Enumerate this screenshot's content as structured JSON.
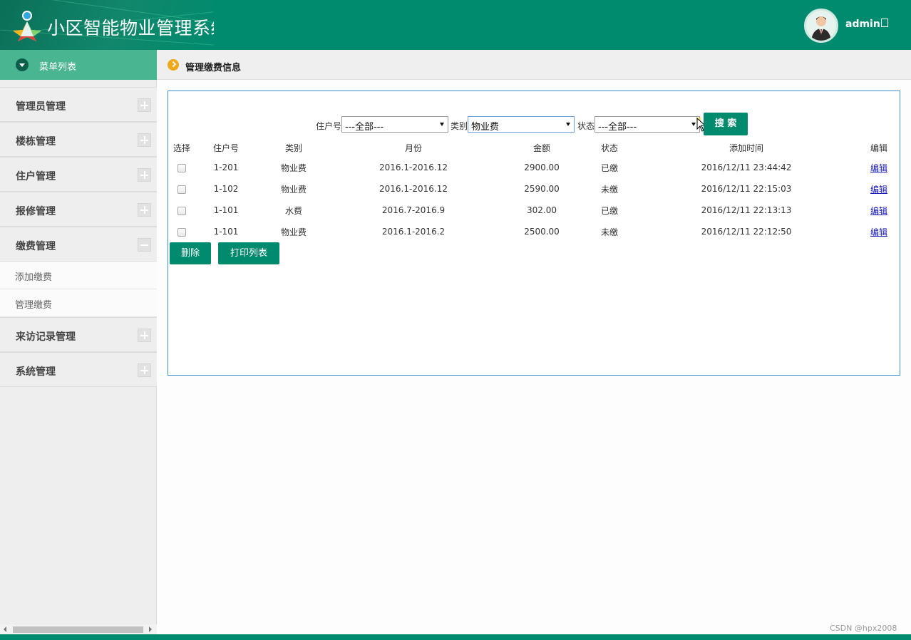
{
  "header": {
    "title": "小区智能物业管理系统",
    "username": "admin"
  },
  "sidebar": {
    "menu_title": "菜单列表",
    "items": [
      {
        "label": "管理员管理",
        "expanded": false
      },
      {
        "label": "楼栋管理",
        "expanded": false
      },
      {
        "label": "住户管理",
        "expanded": false
      },
      {
        "label": "报修管理",
        "expanded": false
      },
      {
        "label": "缴费管理",
        "expanded": true,
        "children": [
          "添加缴费",
          "管理缴费"
        ]
      },
      {
        "label": "来访记录管理",
        "expanded": false
      },
      {
        "label": "系统管理",
        "expanded": false
      }
    ]
  },
  "breadcrumb": {
    "title": "管理缴费信息"
  },
  "filters": {
    "household_label": "住户号",
    "household_value": "---全部---",
    "type_label": "类别",
    "type_value": "物业费",
    "status_label": "状态",
    "status_value": "---全部---",
    "search_button": "搜 索"
  },
  "table": {
    "columns": [
      "选择",
      "住户号",
      "类别",
      "月份",
      "金额",
      "状态",
      "添加时间",
      "编辑"
    ],
    "rows": [
      {
        "household": "1-201",
        "type": "物业费",
        "month": "2016.1-2016.12",
        "amount": "2900.00",
        "status": "已缴",
        "added": "2016/12/11 23:44:42",
        "edit": "编辑"
      },
      {
        "household": "1-102",
        "type": "物业费",
        "month": "2016.1-2016.12",
        "amount": "2590.00",
        "status": "未缴",
        "added": "2016/12/11 22:15:03",
        "edit": "编辑"
      },
      {
        "household": "1-101",
        "type": "水费",
        "month": "2016.7-2016.9",
        "amount": "302.00",
        "status": "已缴",
        "added": "2016/12/11 22:13:13",
        "edit": "编辑"
      },
      {
        "household": "1-101",
        "type": "物业费",
        "month": "2016.1-2016.2",
        "amount": "2500.00",
        "status": "未缴",
        "added": "2016/12/11 22:12:50",
        "edit": "编辑"
      }
    ]
  },
  "actions": {
    "delete": "删除",
    "print": "打印列表"
  },
  "watermark": "CSDN @hpx2008",
  "colors": {
    "brand": "#008b6e",
    "menu_header": "#4ab591",
    "panel_border": "#3a8fd0",
    "crumb_icon": "#f0a818"
  }
}
